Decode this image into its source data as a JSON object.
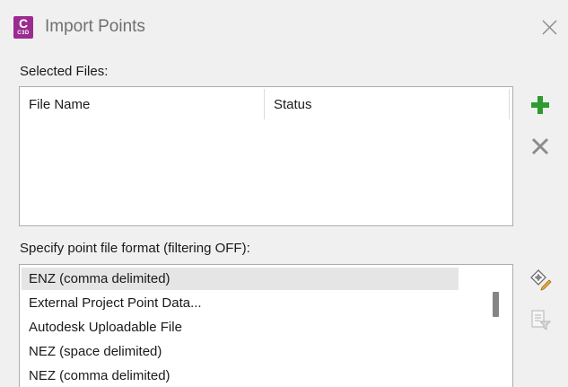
{
  "window": {
    "title": "Import Points",
    "app_icon": {
      "glyph": "C",
      "sub": "C3D",
      "color": "#9b2c8f"
    }
  },
  "selected_files": {
    "label": "Selected Files:",
    "columns": [
      "File Name",
      "Status"
    ],
    "rows": []
  },
  "format": {
    "label": "Specify point file format (filtering OFF):",
    "items": [
      "ENZ (comma delimited)",
      "External Project Point Data...",
      "Autodesk Uploadable File",
      "NEZ (space delimited)",
      "NEZ (comma delimited)"
    ],
    "selected_index": 0
  },
  "icons": {
    "close": "close-icon",
    "add_file": "add-icon",
    "remove_file": "remove-icon",
    "manage_formats": "point-format-manager-icon",
    "filter_formats": "filter-icon"
  },
  "colors": {
    "add_green": "#2e9b2e",
    "remove_gray": "#8c8c8c",
    "accent_magenta": "#9b2c8f"
  }
}
